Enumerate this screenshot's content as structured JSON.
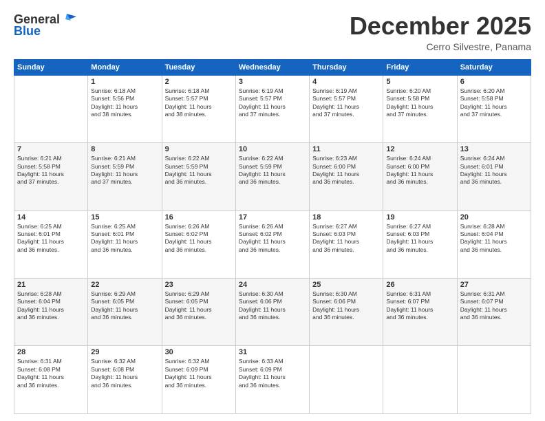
{
  "header": {
    "logo_general": "General",
    "logo_blue": "Blue",
    "month_title": "December 2025",
    "subtitle": "Cerro Silvestre, Panama"
  },
  "days_of_week": [
    "Sunday",
    "Monday",
    "Tuesday",
    "Wednesday",
    "Thursday",
    "Friday",
    "Saturday"
  ],
  "weeks": [
    [
      {
        "day": "",
        "info": ""
      },
      {
        "day": "1",
        "info": "Sunrise: 6:18 AM\nSunset: 5:56 PM\nDaylight: 11 hours\nand 38 minutes."
      },
      {
        "day": "2",
        "info": "Sunrise: 6:18 AM\nSunset: 5:57 PM\nDaylight: 11 hours\nand 38 minutes."
      },
      {
        "day": "3",
        "info": "Sunrise: 6:19 AM\nSunset: 5:57 PM\nDaylight: 11 hours\nand 37 minutes."
      },
      {
        "day": "4",
        "info": "Sunrise: 6:19 AM\nSunset: 5:57 PM\nDaylight: 11 hours\nand 37 minutes."
      },
      {
        "day": "5",
        "info": "Sunrise: 6:20 AM\nSunset: 5:58 PM\nDaylight: 11 hours\nand 37 minutes."
      },
      {
        "day": "6",
        "info": "Sunrise: 6:20 AM\nSunset: 5:58 PM\nDaylight: 11 hours\nand 37 minutes."
      }
    ],
    [
      {
        "day": "7",
        "info": "Sunrise: 6:21 AM\nSunset: 5:58 PM\nDaylight: 11 hours\nand 37 minutes."
      },
      {
        "day": "8",
        "info": "Sunrise: 6:21 AM\nSunset: 5:59 PM\nDaylight: 11 hours\nand 37 minutes."
      },
      {
        "day": "9",
        "info": "Sunrise: 6:22 AM\nSunset: 5:59 PM\nDaylight: 11 hours\nand 36 minutes."
      },
      {
        "day": "10",
        "info": "Sunrise: 6:22 AM\nSunset: 5:59 PM\nDaylight: 11 hours\nand 36 minutes."
      },
      {
        "day": "11",
        "info": "Sunrise: 6:23 AM\nSunset: 6:00 PM\nDaylight: 11 hours\nand 36 minutes."
      },
      {
        "day": "12",
        "info": "Sunrise: 6:24 AM\nSunset: 6:00 PM\nDaylight: 11 hours\nand 36 minutes."
      },
      {
        "day": "13",
        "info": "Sunrise: 6:24 AM\nSunset: 6:01 PM\nDaylight: 11 hours\nand 36 minutes."
      }
    ],
    [
      {
        "day": "14",
        "info": "Sunrise: 6:25 AM\nSunset: 6:01 PM\nDaylight: 11 hours\nand 36 minutes."
      },
      {
        "day": "15",
        "info": "Sunrise: 6:25 AM\nSunset: 6:01 PM\nDaylight: 11 hours\nand 36 minutes."
      },
      {
        "day": "16",
        "info": "Sunrise: 6:26 AM\nSunset: 6:02 PM\nDaylight: 11 hours\nand 36 minutes."
      },
      {
        "day": "17",
        "info": "Sunrise: 6:26 AM\nSunset: 6:02 PM\nDaylight: 11 hours\nand 36 minutes."
      },
      {
        "day": "18",
        "info": "Sunrise: 6:27 AM\nSunset: 6:03 PM\nDaylight: 11 hours\nand 36 minutes."
      },
      {
        "day": "19",
        "info": "Sunrise: 6:27 AM\nSunset: 6:03 PM\nDaylight: 11 hours\nand 36 minutes."
      },
      {
        "day": "20",
        "info": "Sunrise: 6:28 AM\nSunset: 6:04 PM\nDaylight: 11 hours\nand 36 minutes."
      }
    ],
    [
      {
        "day": "21",
        "info": "Sunrise: 6:28 AM\nSunset: 6:04 PM\nDaylight: 11 hours\nand 36 minutes."
      },
      {
        "day": "22",
        "info": "Sunrise: 6:29 AM\nSunset: 6:05 PM\nDaylight: 11 hours\nand 36 minutes."
      },
      {
        "day": "23",
        "info": "Sunrise: 6:29 AM\nSunset: 6:05 PM\nDaylight: 11 hours\nand 36 minutes."
      },
      {
        "day": "24",
        "info": "Sunrise: 6:30 AM\nSunset: 6:06 PM\nDaylight: 11 hours\nand 36 minutes."
      },
      {
        "day": "25",
        "info": "Sunrise: 6:30 AM\nSunset: 6:06 PM\nDaylight: 11 hours\nand 36 minutes."
      },
      {
        "day": "26",
        "info": "Sunrise: 6:31 AM\nSunset: 6:07 PM\nDaylight: 11 hours\nand 36 minutes."
      },
      {
        "day": "27",
        "info": "Sunrise: 6:31 AM\nSunset: 6:07 PM\nDaylight: 11 hours\nand 36 minutes."
      }
    ],
    [
      {
        "day": "28",
        "info": "Sunrise: 6:31 AM\nSunset: 6:08 PM\nDaylight: 11 hours\nand 36 minutes."
      },
      {
        "day": "29",
        "info": "Sunrise: 6:32 AM\nSunset: 6:08 PM\nDaylight: 11 hours\nand 36 minutes."
      },
      {
        "day": "30",
        "info": "Sunrise: 6:32 AM\nSunset: 6:09 PM\nDaylight: 11 hours\nand 36 minutes."
      },
      {
        "day": "31",
        "info": "Sunrise: 6:33 AM\nSunset: 6:09 PM\nDaylight: 11 hours\nand 36 minutes."
      },
      {
        "day": "",
        "info": ""
      },
      {
        "day": "",
        "info": ""
      },
      {
        "day": "",
        "info": ""
      }
    ]
  ]
}
